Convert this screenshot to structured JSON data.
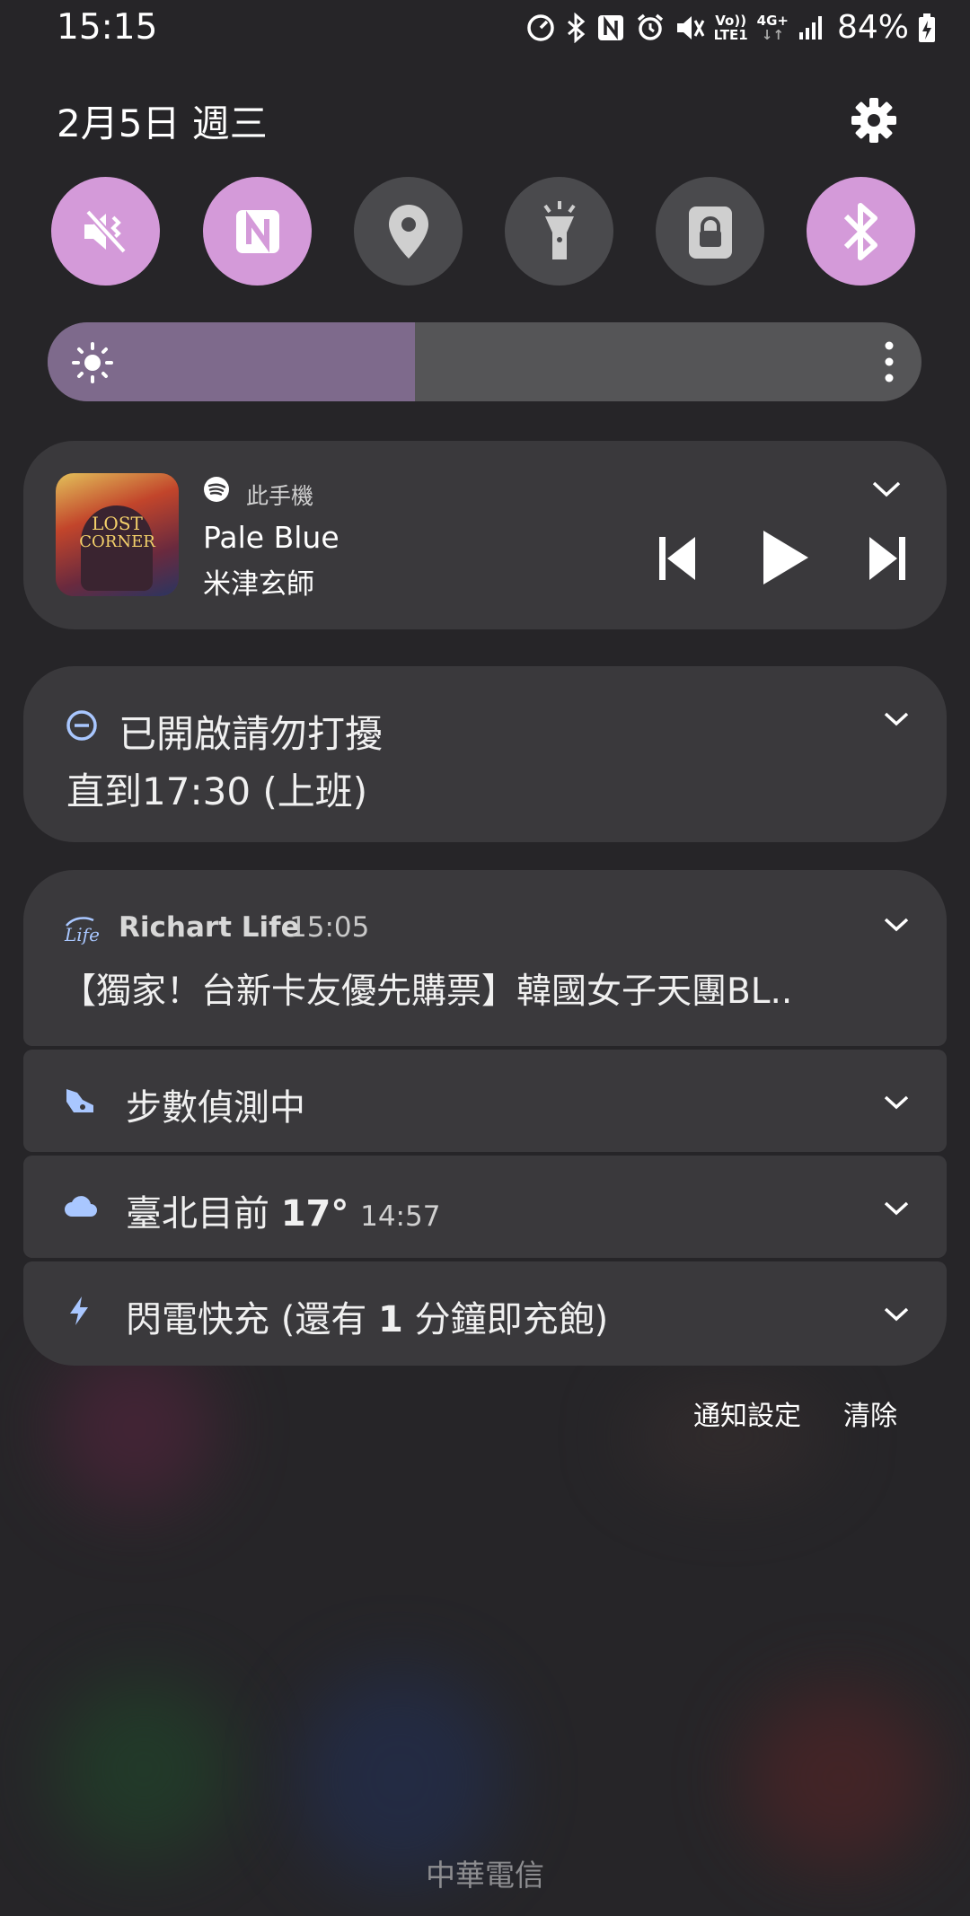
{
  "status_bar": {
    "time": "15:15",
    "network_volte": "Vo))",
    "network_lte": "LTE1",
    "network_type": "4G+",
    "battery_percent": "84%"
  },
  "header": {
    "date": "2月5日 週三"
  },
  "quick_toggles": [
    {
      "name": "mute",
      "icon": "mute-vibrate-icon",
      "state": "on"
    },
    {
      "name": "nfc",
      "icon": "nfc-icon",
      "state": "on"
    },
    {
      "name": "location",
      "icon": "location-icon",
      "state": "off"
    },
    {
      "name": "flashlight",
      "icon": "flashlight-icon",
      "state": "off"
    },
    {
      "name": "lock",
      "icon": "lock-icon",
      "state": "off"
    },
    {
      "name": "bluetooth",
      "icon": "bluetooth-icon",
      "state": "on"
    }
  ],
  "brightness": {
    "level": 0.42
  },
  "media": {
    "source": "此手機",
    "title": "Pale Blue",
    "artist": "米津玄師",
    "album_art_text_1": "LOST",
    "album_art_text_2": "CORNER"
  },
  "dnd": {
    "title": "已開啟請勿打擾",
    "subtitle": "直到17:30 (上班)"
  },
  "notifications": {
    "richart": {
      "app": "Richart Life",
      "time": "15:05",
      "text": "【獨家！台新卡友優先購票】韓國女子天團BL.."
    },
    "steps": {
      "text": "步數偵測中"
    },
    "weather": {
      "text_prefix": "臺北目前",
      "temp": "17°",
      "time": "14:57"
    },
    "charging": {
      "text_prefix": "閃電快充 (還有",
      "minutes": "1",
      "text_suffix": "分鐘即充飽)"
    }
  },
  "footer": {
    "notification_settings": "通知設定",
    "clear": "清除"
  },
  "carrier": "中華電信",
  "colors": {
    "toggle_on": "#D49AD9",
    "toggle_off": "#4A4A4D",
    "brightness_fill": "#7E6A8C"
  }
}
